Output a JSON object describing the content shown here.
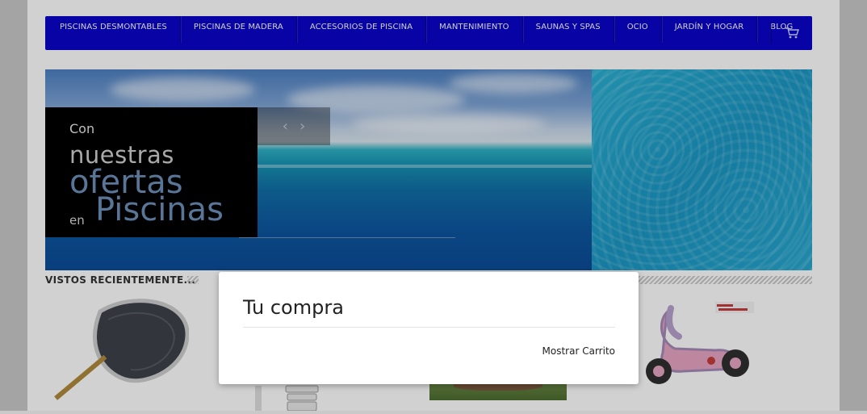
{
  "nav": {
    "items": [
      {
        "label": "PISCINAS DESMONTABLES"
      },
      {
        "label": "PISCINAS DE MADERA"
      },
      {
        "label": "ACCESORIOS DE PISCINA"
      },
      {
        "label": "MANTENIMIENTO"
      },
      {
        "label": "SAUNAS Y SPAS"
      },
      {
        "label": "OCIO"
      },
      {
        "label": "JARDÍN Y HOGAR"
      },
      {
        "label": "BLOG"
      }
    ],
    "cart_icon": "shopping-cart-icon"
  },
  "hero": {
    "line1": "Con",
    "line2": "nuestras",
    "line3": "ofertas",
    "line4a": "en",
    "line4b": "Piscinas",
    "prev_icon": "chevron-left-icon",
    "next_icon": "chevron-right-icon",
    "prev_glyph": "‹",
    "next_glyph": "›"
  },
  "recent": {
    "title": "VISTOS RECIENTEMENTE..."
  },
  "modal": {
    "title": "Tu compra",
    "link": "Mostrar Carrito"
  },
  "colors": {
    "nav_bg": "#0a04c8",
    "promo_accent": "#6d8fba"
  }
}
